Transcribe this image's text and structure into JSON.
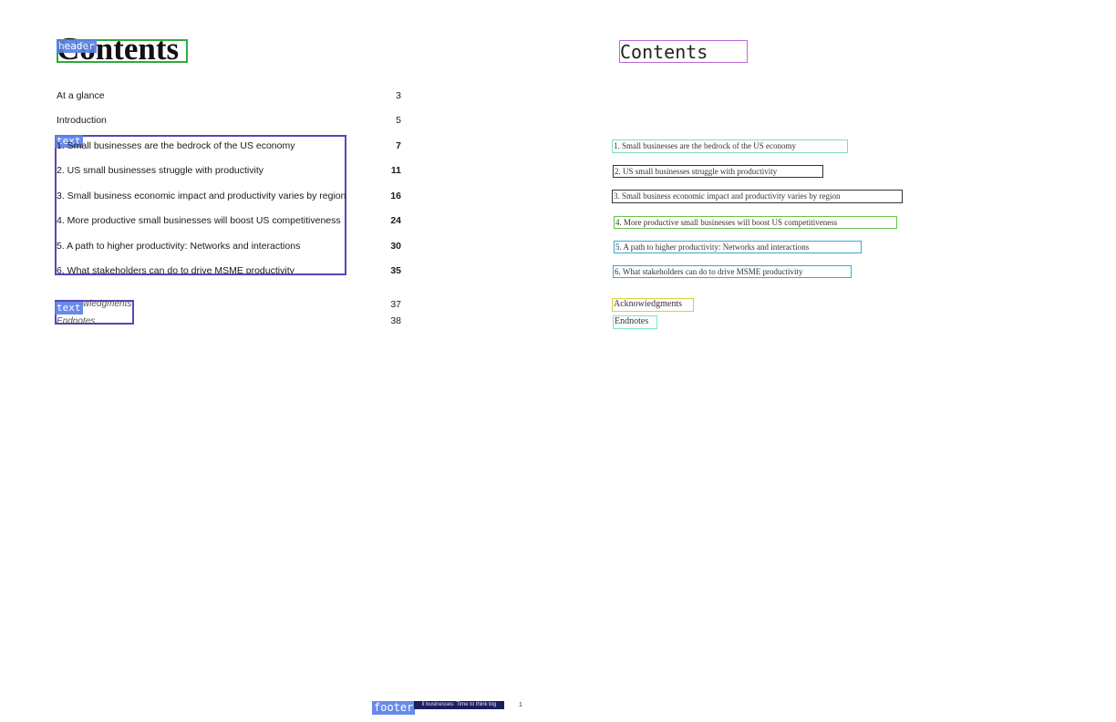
{
  "left_page": {
    "title": "Contents",
    "header_tag": "header",
    "text_tag": "text",
    "text_tag_2": "text",
    "footer_tag": "footer",
    "toc": [
      {
        "label": "At a glance",
        "page": "3"
      },
      {
        "label": "Introduction",
        "page": "5"
      },
      {
        "label": "1. Small businesses are the bedrock of the US economy",
        "page": "7"
      },
      {
        "label": "2. US small businesses struggle with productivity",
        "page": "11"
      },
      {
        "label": "3. Small business economic impact and productivity varies by region",
        "page": "16"
      },
      {
        "label": "4. More productive small businesses will boost US competitiveness",
        "page": "24"
      },
      {
        "label": "5. A path to higher productivity: Networks and interactions",
        "page": "30"
      },
      {
        "label": "6. What stakeholders can do to drive MSME productivity",
        "page": "35"
      }
    ],
    "extras": [
      {
        "label": "Acknowledgments",
        "visible_label": "wledgments",
        "page": "37"
      },
      {
        "label": "Endnotes",
        "page": "38"
      }
    ],
    "footer_text": "ll businesses: Time to think big",
    "footer_page": "1"
  },
  "right_page": {
    "title": "Contents",
    "lines": [
      "1. Small businesses are the bedrock of the US economy",
      "2. US small businesses struggle with productivity",
      "3. Small business economic impact and productivity varies by region",
      "4. More productive small businesses will boost US competitiveness",
      "5. A path to higher productivity: Networks and interactions",
      "6. What stakeholders can do to drive MSME productivity",
      "Acknowiedgments",
      "Endnotes"
    ]
  },
  "colors": {
    "header_box": "#2eaa3e",
    "text_box": "#5a45b8",
    "tag_fill": "#5b82e8",
    "footer_fill": "#1b1f5e"
  }
}
